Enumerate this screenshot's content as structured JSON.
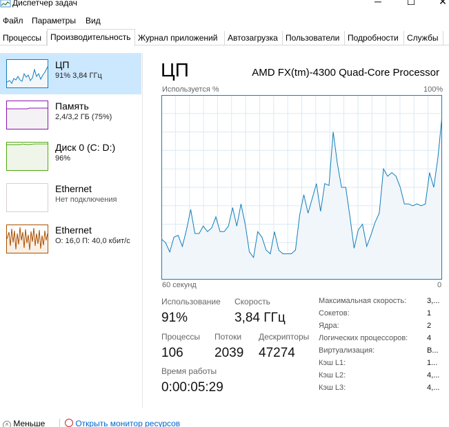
{
  "window": {
    "title": "Диспетчер задач",
    "minimize": "─",
    "maximize": "☐",
    "close": "✕"
  },
  "menu": [
    "Файл",
    "Параметры",
    "Вид"
  ],
  "tabs": [
    {
      "label": "Процессы",
      "active": false
    },
    {
      "label": "Производительность",
      "active": true
    },
    {
      "label": "Журнал приложений",
      "active": false
    },
    {
      "label": "Автозагрузка",
      "active": false
    },
    {
      "label": "Пользователи",
      "active": false
    },
    {
      "label": "Подробности",
      "active": false
    },
    {
      "label": "Службы",
      "active": false
    }
  ],
  "sidebar": {
    "items": [
      {
        "title": "ЦП",
        "sub": "91%  3,84 ГГц",
        "selected": true,
        "color": "#117dbb"
      },
      {
        "title": "Память",
        "sub": "2,4/3,2 ГБ (75%)",
        "selected": false,
        "color": "#8b12ae"
      },
      {
        "title": "Диск 0 (C: D:)",
        "sub": "96%",
        "selected": false,
        "color": "#4da60c"
      },
      {
        "title": "Ethernet",
        "sub": "Нет подключения",
        "selected": false,
        "color": "#a74f01"
      },
      {
        "title": "Ethernet",
        "sub": "О: 16,0  П: 40,0 кбит/с",
        "selected": false,
        "color": "#a74f01"
      }
    ]
  },
  "main": {
    "title": "ЦП",
    "model": "AMD FX(tm)-4300 Quad-Core Processor",
    "chart": {
      "top_left": "Используется %",
      "top_right": "100%",
      "bottom_left": "60 секунд",
      "bottom_right": "0",
      "line_color": "#117dbb",
      "fill_color": "#f1f6fa",
      "grid_color": "#d9eaf4"
    },
    "stats": {
      "usage_label": "Использование",
      "usage_value": "91%",
      "speed_label": "Скорость",
      "speed_value": "3,84 ГГц",
      "processes_label": "Процессы",
      "processes_value": "106",
      "threads_label": "Потоки",
      "threads_value": "2039",
      "handles_label": "Дескрипторы",
      "handles_value": "47274",
      "uptime_label": "Время работы",
      "uptime_value": "0:00:05:29"
    },
    "specs": [
      {
        "label": "Максимальная скорость:",
        "value": "3,..."
      },
      {
        "label": "Сокетов:",
        "value": "1"
      },
      {
        "label": "Ядра:",
        "value": "2"
      },
      {
        "label": "Логических процессоров:",
        "value": "4"
      },
      {
        "label": "Виртуализация:",
        "value": "В..."
      },
      {
        "label": "Кэш L1:",
        "value": "1..."
      },
      {
        "label": "Кэш L2:",
        "value": "4,..."
      },
      {
        "label": "Кэш L3:",
        "value": "4,..."
      }
    ]
  },
  "footer": {
    "less_label": "Меньше",
    "monitor_label": "Открыть монитор ресурсов"
  },
  "chart_data": {
    "type": "area",
    "x_range_seconds": [
      60,
      0
    ],
    "ylim": [
      0,
      100
    ],
    "grid": true,
    "values": [
      22,
      20,
      15,
      23,
      24,
      18,
      27,
      38,
      25,
      25,
      29,
      26,
      28,
      34,
      26,
      26,
      29,
      39,
      29,
      41,
      30,
      15,
      12,
      26,
      23,
      16,
      14,
      26,
      16,
      14,
      14,
      14,
      16,
      35,
      46,
      36,
      44,
      52,
      37,
      52,
      51,
      80,
      63,
      50,
      50,
      34,
      17,
      27,
      30,
      18,
      24,
      31,
      36,
      60,
      56,
      58,
      56,
      50,
      41,
      41,
      40,
      41,
      40,
      41,
      58,
      50,
      66,
      89
    ]
  }
}
